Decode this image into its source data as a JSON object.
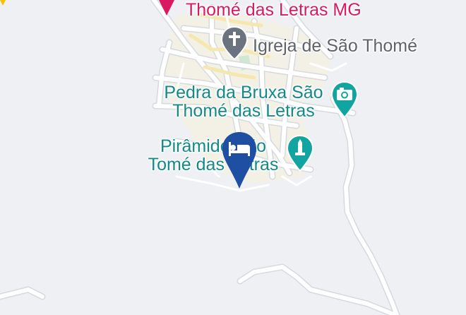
{
  "colors": {
    "background": "#eef0f3",
    "road": "#ffffff",
    "road_edge": "#d6d9de",
    "urban": "#f4ecc8",
    "park": "#cfe8d1",
    "pink": "#d81b60",
    "gray_poi": "#6b7280",
    "teal": "#12a4a0",
    "teal_text": "#138a87",
    "hotel_marker": "#1e4fa3"
  },
  "places": {
    "town": {
      "line2": "Thomé das Letras MG",
      "icon": "pink-pin-icon"
    },
    "church": {
      "label": "Igreja de São Thomé",
      "icon": "church-cross-icon"
    },
    "pedra": {
      "line1": "Pedra da Bruxa São",
      "line2": "Thomé das Letras",
      "icon": "camera-icon"
    },
    "piramide": {
      "line1": "Pirâmide São",
      "line2": "Tomé das Letras",
      "icon": "monument-icon"
    }
  },
  "hotel_marker": {
    "icon": "bed-icon"
  }
}
